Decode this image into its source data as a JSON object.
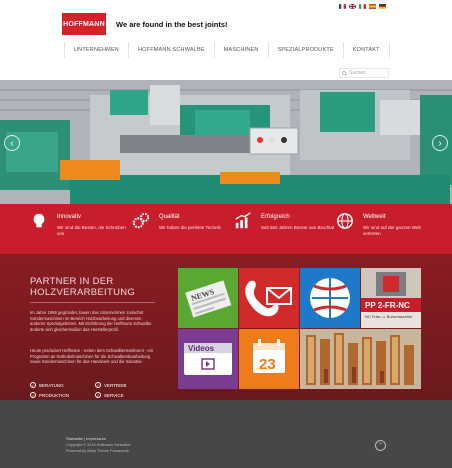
{
  "header": {
    "logo_text": "HOFFMANN",
    "tagline": "We are found in the best joints!",
    "search_placeholder": "Suchen",
    "languages": [
      {
        "name": "Français",
        "colors": [
          "#1f3f99",
          "#ffffff",
          "#d6202a"
        ]
      },
      {
        "name": "English",
        "colors": [
          "#cf1f2a",
          "#ffffff",
          "#2a3f8f"
        ]
      },
      {
        "name": "Italiano",
        "colors": [
          "#2e9b45",
          "#ffffff",
          "#d6202a"
        ]
      },
      {
        "name": "Español",
        "colors": [
          "#c6202a",
          "#f1c40f",
          "#c6202a"
        ]
      },
      {
        "name": "Deutsch",
        "colors": [
          "#111111",
          "#d6202a",
          "#f1c40f"
        ]
      }
    ]
  },
  "nav": [
    {
      "label": "UNTERNEHMEN"
    },
    {
      "label": "HOFFMANN SCHWALBE"
    },
    {
      "label": "MASCHINEN"
    },
    {
      "label": "SPEZIALPRODUKTE"
    },
    {
      "label": "KONTAKT"
    }
  ],
  "hero": {
    "prev": "‹",
    "next": "›"
  },
  "features": [
    {
      "icon": "lightbulb-icon",
      "title": "Innovativ",
      "text": "Wir sind die Besten, die Schreiben uns"
    },
    {
      "icon": "gears-icon",
      "title": "Qualität",
      "text": "Wir haben die perfekte Technik"
    },
    {
      "icon": "growth-chart-icon",
      "title": "Erfolgreich",
      "text": "Seit 550 Jahren Besser aus Bruchtal"
    },
    {
      "icon": "globe-icon",
      "title": "Weltweit",
      "text": "Wir sind auf der ganzen Welt vertreten"
    }
  ],
  "content": {
    "title": "PARTNER IN DER HOLZVERARBEITUNG",
    "para1": "Im Jahre 1986 gegründet, bauen das Unternehmen zunächst Sondermaschinen im Bereich Holzbearbeitung und diversen anderen Spezialgebieten. Mit Einführung der Hoffmann Schwalbe änderte sich gleichermaßen das Herstellerprofil.",
    "para2": "Heute produziert Hoffmann - neben dem Schwalbensortiment - ein Programm an Nuthobelmaschinen für die Schwalbenbearbeitung sowie Sondermaschinen für das Handwerk und die Industrie.",
    "checks": [
      "BERATUNG",
      "VERTRIEB",
      "PRODUKTION",
      "SERVICE"
    ],
    "check_mark": "✓"
  },
  "tiles": {
    "news": {
      "label": "NEWS",
      "color": "#5aa832"
    },
    "contact": {
      "label": "",
      "color": "#d12a2a"
    },
    "global": {
      "label": "",
      "color": "#1e79c9"
    },
    "product": {
      "label": "PP 2-FR-NC",
      "sub": "NC Fräs- u. Bohrmaschine"
    },
    "videos": {
      "label": "Videos",
      "color": "#7b3d91"
    },
    "calendar": {
      "label": "23",
      "color": "#ef7c1a"
    },
    "wood": {
      "label": ""
    }
  },
  "footer": {
    "links": "Startseite  |  Impressum",
    "copyright": "Copyright © 2013 Hoffmann Schwalbe",
    "powered": "Powered by Warp Theme Framework",
    "to_top": "⌃"
  }
}
